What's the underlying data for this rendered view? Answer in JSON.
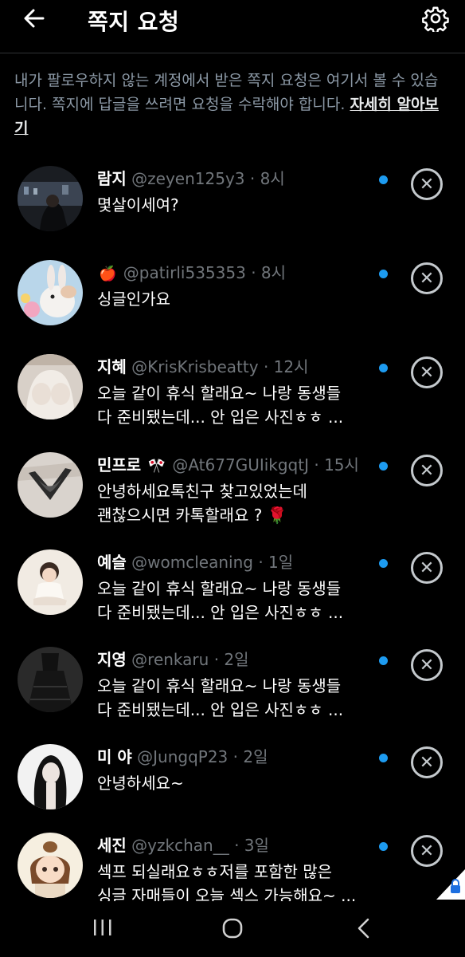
{
  "header": {
    "title": "쪽지 요청"
  },
  "notice": {
    "text": "내가 팔로우하지 않는 계정에서 받은 쪽지 요청은 여기서 볼 수 있습니다. 쪽지에 답글을 쓰려면 요청을 수락해야 합니다. ",
    "link": "자세히 알아보기"
  },
  "requests": [
    {
      "name": "람지",
      "badge": "",
      "handle": "@zeyen125y3",
      "time": "· 8시",
      "message": "몇살이세여?"
    },
    {
      "name": "",
      "badge": "🍎",
      "handle": "@patirli535353",
      "time": "· 8시",
      "message": "싱글인가요"
    },
    {
      "name": "지혜",
      "badge": "",
      "handle": "@KrisKrisbeatty",
      "time": "· 12시",
      "message": "오늘 같이 휴식 할래요~ 나랑 동생들\n다 준비됐는데... 안 입은 사진ㅎㅎ ..."
    },
    {
      "name": "민프로",
      "badge": "🎌",
      "handle": "@At677GUIikgqtJ",
      "time": "· 15시",
      "message": "안녕하세요톡친구 찾고있었는데\n괜찮으시면 카톡할래요 ? 🌹"
    },
    {
      "name": "예슬",
      "badge": "",
      "handle": "@womcleaning",
      "time": "· 1일",
      "message": "오늘 같이 휴식 할래요~ 나랑 동생들\n다 준비됐는데... 안 입은 사진ㅎㅎ ..."
    },
    {
      "name": "지영",
      "badge": "",
      "handle": "@renkaru",
      "time": "· 2일",
      "message": "오늘 같이 휴식 할래요~ 나랑 동생들\n다 준비됐는데... 안 입은 사진ㅎㅎ ..."
    },
    {
      "name": "미 야",
      "badge": "",
      "handle": "@JungqP23",
      "time": "· 2일",
      "message": "안녕하세요~"
    },
    {
      "name": "세진",
      "badge": "",
      "handle": "@yzkchan__",
      "time": "· 3일",
      "message": "섹프 되실래요ㅎㅎ저를 포함한 많은\n싱글 자매들이 오늘 섹스 가능해요~ ..."
    }
  ],
  "icons": {
    "back": "arrow-left-icon",
    "settings": "gear-icon",
    "dismiss": "close-icon",
    "unread": "unread-dot",
    "nav": [
      "recent-apps-icon",
      "home-icon",
      "back-chevron-icon"
    ]
  },
  "colors": {
    "background": "#000000",
    "accent": "#1d9bf0",
    "muted": "#71767b"
  }
}
